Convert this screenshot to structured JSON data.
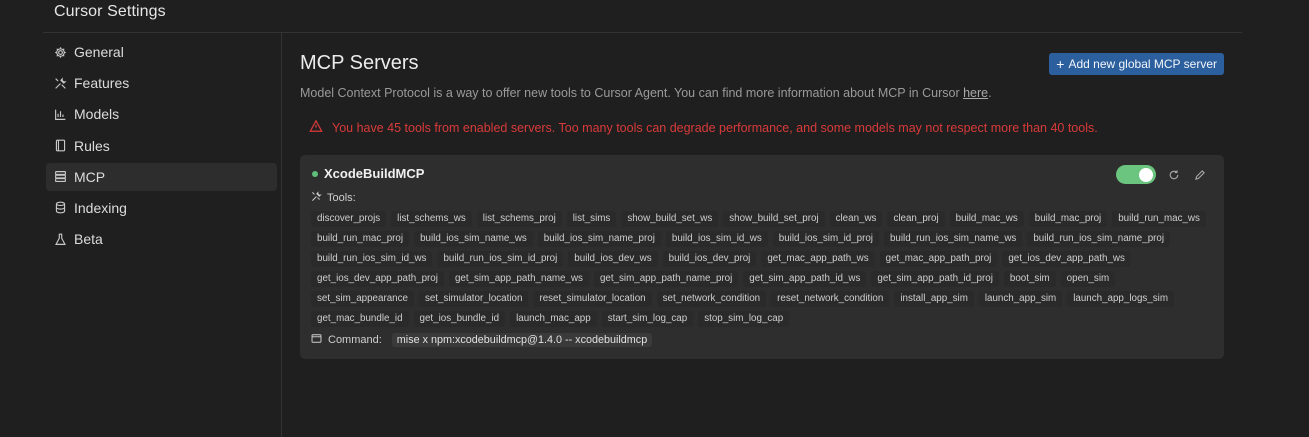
{
  "window": {
    "title": "Cursor Settings"
  },
  "sidebar": {
    "items": [
      {
        "label": "General",
        "icon": "gear-icon"
      },
      {
        "label": "Features",
        "icon": "tools-icon"
      },
      {
        "label": "Models",
        "icon": "bar-chart-icon"
      },
      {
        "label": "Rules",
        "icon": "book-icon"
      },
      {
        "label": "MCP",
        "icon": "server-icon",
        "active": true
      },
      {
        "label": "Indexing",
        "icon": "database-icon"
      },
      {
        "label": "Beta",
        "icon": "flask-icon"
      }
    ]
  },
  "main": {
    "title": "MCP Servers",
    "add_button": {
      "label": "Add new global MCP server",
      "icon": "plus-icon"
    },
    "description": {
      "text": "Model Context Protocol is a way to offer new tools to Cursor Agent. You can find more information about MCP in Cursor ",
      "link": "here",
      "suffix": "."
    },
    "warning": {
      "icon": "warning-triangle-icon",
      "text": "You have 45 tools from enabled servers. Too many tools can degrade performance, and some models may not respect more than 40 tools.",
      "color": "#d93a3a"
    },
    "server": {
      "name": "XcodeBuildMCP",
      "status_color": "#5fbf7a",
      "enabled": true,
      "toggle_color": "#6bc57f",
      "tools_label": "Tools:",
      "tools": [
        "discover_projs",
        "list_schems_ws",
        "list_schems_proj",
        "list_sims",
        "show_build_set_ws",
        "show_build_set_proj",
        "clean_ws",
        "clean_proj",
        "build_mac_ws",
        "build_mac_proj",
        "build_run_mac_ws",
        "build_run_mac_proj",
        "build_ios_sim_name_ws",
        "build_ios_sim_name_proj",
        "build_ios_sim_id_ws",
        "build_ios_sim_id_proj",
        "build_run_ios_sim_name_ws",
        "build_run_ios_sim_name_proj",
        "build_run_ios_sim_id_ws",
        "build_run_ios_sim_id_proj",
        "build_ios_dev_ws",
        "build_ios_dev_proj",
        "get_mac_app_path_ws",
        "get_mac_app_path_proj",
        "get_ios_dev_app_path_ws",
        "get_ios_dev_app_path_proj",
        "get_sim_app_path_name_ws",
        "get_sim_app_path_name_proj",
        "get_sim_app_path_id_ws",
        "get_sim_app_path_id_proj",
        "boot_sim",
        "open_sim",
        "set_sim_appearance",
        "set_simulator_location",
        "reset_simulator_location",
        "set_network_condition",
        "reset_network_condition",
        "install_app_sim",
        "launch_app_sim",
        "launch_app_logs_sim",
        "get_mac_bundle_id",
        "get_ios_bundle_id",
        "launch_mac_app",
        "start_sim_log_cap",
        "stop_sim_log_cap"
      ],
      "command_label": "Command:",
      "command_value": "mise x npm:xcodebuildmcp@1.4.0 -- xcodebuildmcp"
    }
  },
  "colors": {
    "background": "#1f1f1f",
    "card": "#2e2e2e",
    "accent_button": "#2c5f9e"
  }
}
